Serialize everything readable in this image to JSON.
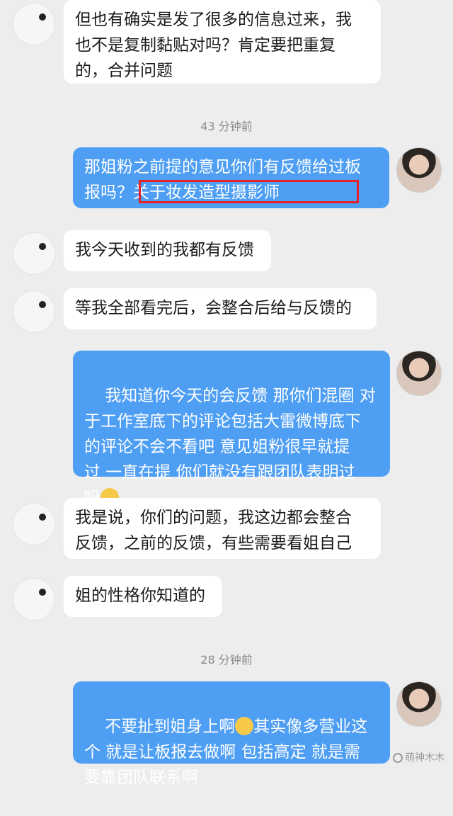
{
  "messages": [
    {
      "side": "in",
      "text": "但也有确实是发了很多的信息过来，我\n也不是复制黏贴对吗？肯定要把重复\n的，合并问题"
    },
    {
      "side": "out",
      "text": "那姐粉之前提的意见你们有反馈给过板\n报吗？关于妆发造型摄影师"
    },
    {
      "side": "in",
      "text": "我今天收到的我都有反馈"
    },
    {
      "side": "in",
      "text": "等我全部看完后，会整合后给与反馈的"
    },
    {
      "side": "out",
      "text_before": "我知道你今天的会反馈 那你们混圈 对\n于工作室底下的评论包括大雷微博底下\n的评论不会不看吧 意见姐粉很早就提\n过 一直在提 你们就没有跟团队表明过\n吗",
      "emoji": "crying-face"
    },
    {
      "side": "in",
      "text": "我是说，你们的问题，我这边都会整合\n反馈，之前的反馈，有些需要看姐自己"
    },
    {
      "side": "in",
      "text": "姐的性格你知道的"
    },
    {
      "side": "out",
      "text_before": "不要扯到姐身上啊",
      "emoji": "crying-face",
      "text_after": "其实像多营业这\n个 就是让板报去做啊 包括高定 就是需\n要靠团队联系啊"
    }
  ],
  "timestamps": [
    "43 分钟前",
    "28 分钟前"
  ],
  "watermark": "萌神木木",
  "colors": {
    "outgoing_bubble": "#4e9ef3",
    "incoming_bubble": "#ffffff",
    "background": "#ededed",
    "highlight_box": "#e2242a"
  }
}
